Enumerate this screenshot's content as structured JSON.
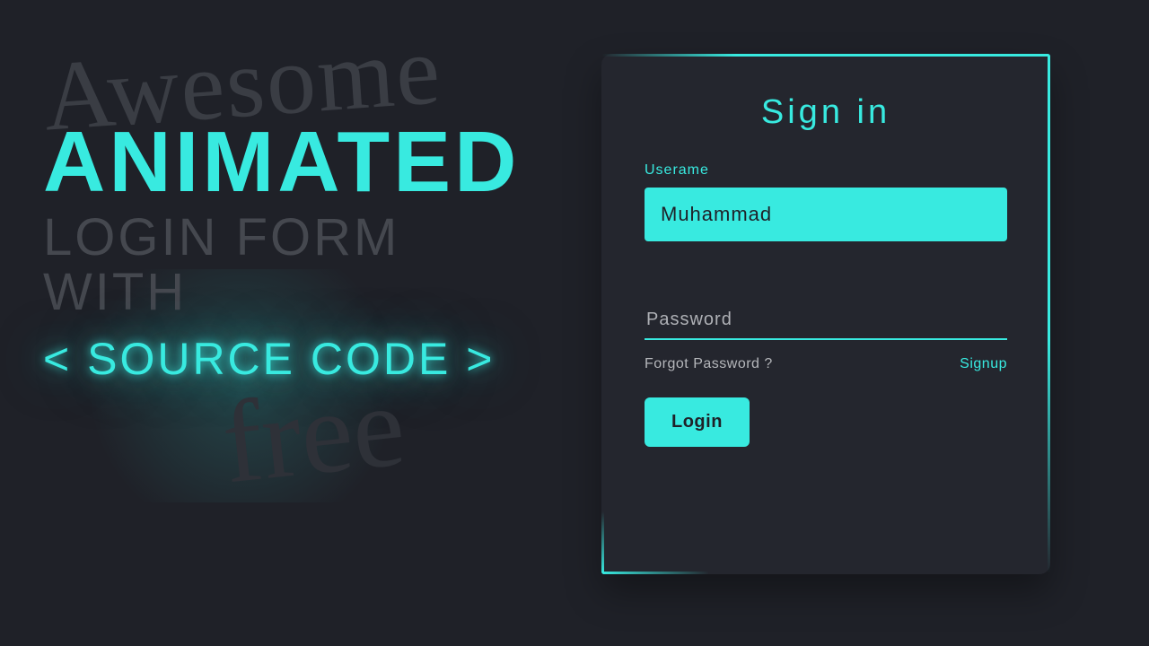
{
  "promo": {
    "awesome": "Awesome",
    "animated": "ANIMATED",
    "login_form": "LOGIN FORM WITH",
    "source_code": "< SOURCE CODE >",
    "free": "free"
  },
  "card": {
    "title": "Sign in",
    "username_label": "Userame",
    "username_value": "Muhammad",
    "password_placeholder": "Password",
    "password_value": "",
    "forgot": "Forgot Password ?",
    "signup": "Signup",
    "login_button": "Login"
  },
  "colors": {
    "accent": "#38eae0",
    "bg": "#1f2128",
    "card_bg": "#24262e"
  }
}
